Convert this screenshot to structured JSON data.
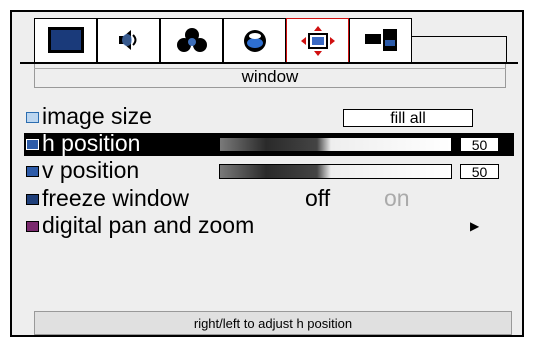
{
  "tabs": [
    {
      "icon": "monitor-icon"
    },
    {
      "icon": "speaker-icon"
    },
    {
      "icon": "color-icon"
    },
    {
      "icon": "target-icon"
    },
    {
      "icon": "window-icon",
      "active": true
    },
    {
      "icon": "layout-icon"
    }
  ],
  "header": {
    "title": "window"
  },
  "menu": [
    {
      "label": "image size",
      "value": "fill all"
    },
    {
      "label": "h position",
      "value": "50",
      "selected": true
    },
    {
      "label": "v position",
      "value": "50"
    },
    {
      "label": "freeze window",
      "options": [
        "off",
        "on"
      ],
      "selected_option": "off"
    },
    {
      "label": "digital pan and zoom",
      "submenu_icon": "right-arrow-icon"
    }
  ],
  "status": {
    "text": "right/left to adjust h position"
  },
  "colors": {
    "active_tab_border": "#d01010",
    "selected_row_bg": "#000000",
    "panel_bg": "#eeeeee"
  }
}
